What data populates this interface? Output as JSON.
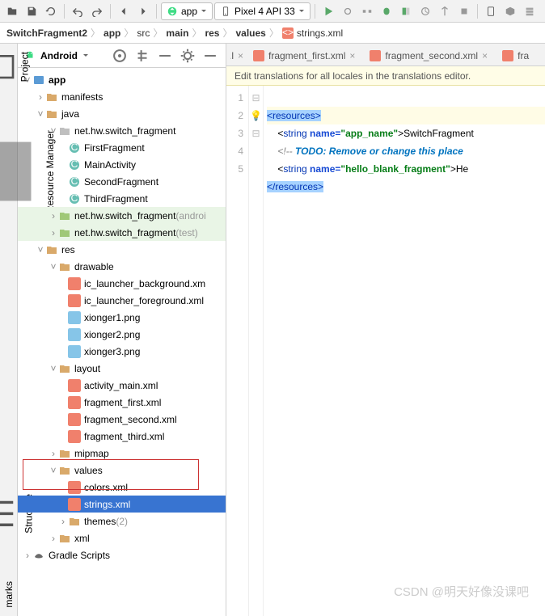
{
  "toolbar": {
    "app_config": "app",
    "device": "Pixel 4 API 33"
  },
  "breadcrumb": {
    "root": "SwitchFragment2",
    "p1": "app",
    "p2": "src",
    "p3": "main",
    "p4": "res",
    "p5": "values",
    "file": "strings.xml"
  },
  "sidebar": {
    "title": "Android"
  },
  "tree": {
    "app": "app",
    "manifests": "manifests",
    "java": "java",
    "pkg1": "net.hw.switch_fragment",
    "c1": "FirstFragment",
    "c2": "MainActivity",
    "c3": "SecondFragment",
    "c4": "ThirdFragment",
    "pkg2": "net.hw.switch_fragment",
    "pkg2s": "(androi",
    "pkg3": "net.hw.switch_fragment",
    "pkg3s": "(test)",
    "res": "res",
    "drawable": "drawable",
    "d1": "ic_launcher_background.xm",
    "d2": "ic_launcher_foreground.xml",
    "d3": "xionger1.png",
    "d4": "xionger2.png",
    "d5": "xionger3.png",
    "layout": "layout",
    "l1": "activity_main.xml",
    "l2": "fragment_first.xml",
    "l3": "fragment_second.xml",
    "l4": "fragment_third.xml",
    "mipmap": "mipmap",
    "values": "values",
    "v1": "colors.xml",
    "v2": "strings.xml",
    "themes": "themes",
    "themes_c": "(2)",
    "xml": "xml",
    "gradle": "Gradle Scripts"
  },
  "tabs": {
    "t1": "fragment_first.xml",
    "t2": "fragment_second.xml",
    "t3": "fra"
  },
  "banner": "Edit translations for all locales in the translations editor.",
  "code": {
    "ln1": "1",
    "ln2": "2",
    "ln3": "3",
    "ln4": "4",
    "ln5": "5",
    "l1a": "<resources>",
    "l2a": "    <",
    "l2b": "string ",
    "l2c": "name=",
    "l2d": "\"app_name\"",
    "l2e": ">",
    "l2f": "SwitchFragment",
    "l3a": "    <!-- ",
    "l3b": "TODO: Remove or change this place",
    "l4a": "    <",
    "l4b": "string ",
    "l4c": "name=",
    "l4d": "\"hello_blank_fragment\"",
    "l4e": ">",
    "l4f": "He",
    "l5a": "</resources>"
  },
  "watermark": "CSDN @明天好像没课吧"
}
